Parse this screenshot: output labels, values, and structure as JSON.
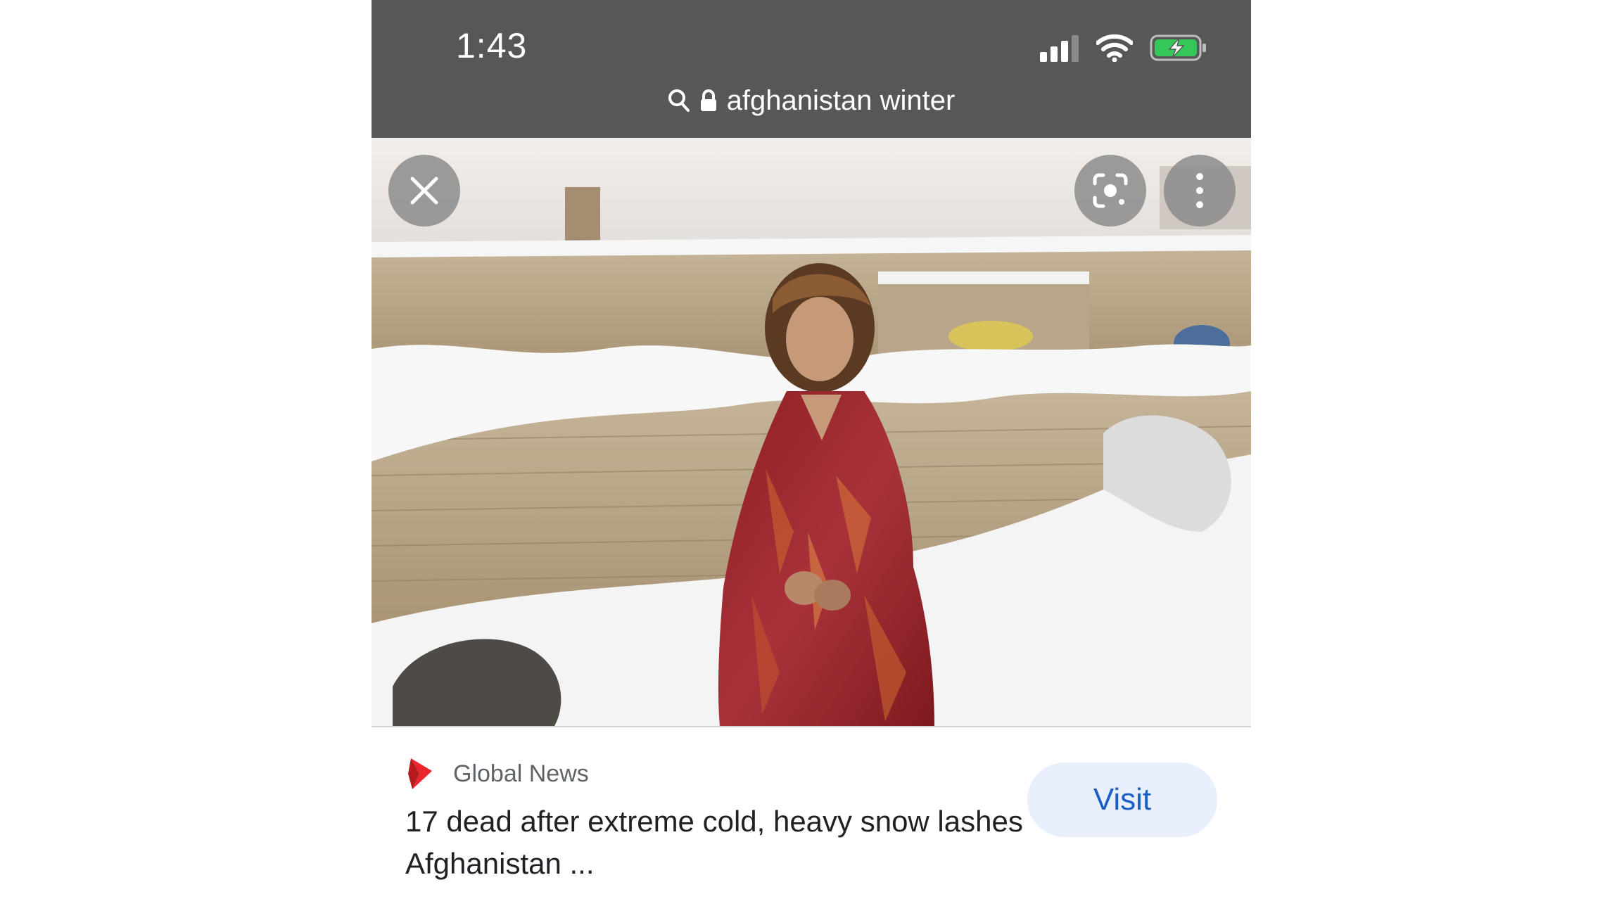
{
  "status_bar": {
    "time": "1:43",
    "icons": [
      "cellular-signal-icon",
      "wifi-icon",
      "battery-charging-icon"
    ],
    "battery_color": "#34c759"
  },
  "url_bar": {
    "query": "afghanistan winter",
    "icons": [
      "search-icon",
      "lock-icon"
    ]
  },
  "image_viewer": {
    "close_icon": "close-icon",
    "lens_icon": "google-lens-icon",
    "more_icon": "more-vertical-icon"
  },
  "result": {
    "source_name": "Global News",
    "source_logo_color": "#e8262b",
    "title": "17 dead after extreme cold, heavy snow lashes Afghanistan ...",
    "visit_label": "Visit"
  },
  "colors": {
    "topbar": "#575757",
    "visit_bg": "#e8f0fe",
    "visit_text": "#1a5fc7"
  }
}
